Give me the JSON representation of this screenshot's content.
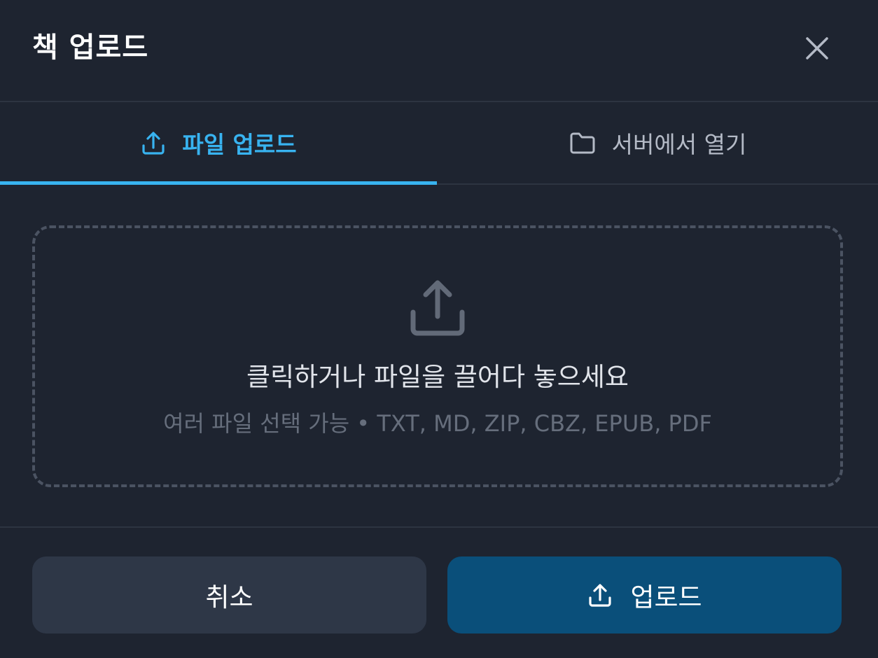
{
  "dialog": {
    "title": "책 업로드"
  },
  "tabs": [
    {
      "label": "파일 업로드",
      "icon": "upload-icon",
      "active": true
    },
    {
      "label": "서버에서 열기",
      "icon": "folder-icon",
      "active": false
    }
  ],
  "dropzone": {
    "icon": "upload-icon",
    "primary_text": "클릭하거나 파일을 끌어다 놓으세요",
    "secondary_text": "여러 파일 선택 가능 • TXT, MD, ZIP, CBZ, EPUB, PDF"
  },
  "buttons": {
    "cancel_label": "취소",
    "upload_label": "업로드"
  },
  "colors": {
    "background": "#1e2430",
    "accent": "#38b3f0",
    "upload_button": "#0a4f7a",
    "cancel_button": "#2e3747"
  }
}
